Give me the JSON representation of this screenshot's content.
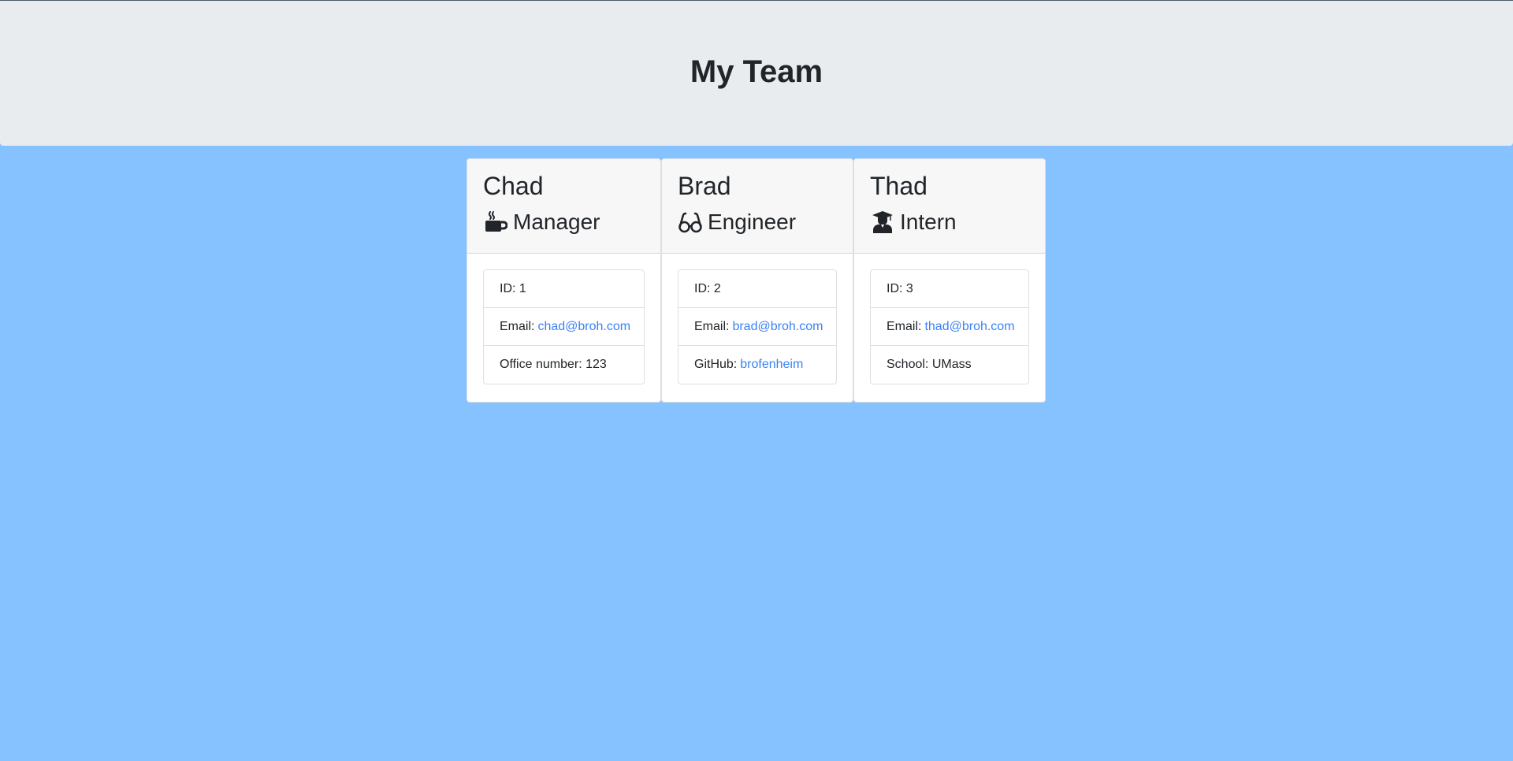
{
  "header": {
    "title": "My Team"
  },
  "team": [
    {
      "name": "Chad",
      "role": "Manager",
      "role_icon": "mug-hot-icon",
      "id_label": "ID: 1",
      "email_label": "Email:",
      "email": "chad@broh.com",
      "extra_label": "Office number: 123",
      "extra_link": ""
    },
    {
      "name": "Brad",
      "role": "Engineer",
      "role_icon": "glasses-icon",
      "id_label": "ID: 2",
      "email_label": "Email:",
      "email": "brad@broh.com",
      "extra_label": "GitHub:",
      "extra_link": "brofenheim"
    },
    {
      "name": "Thad",
      "role": "Intern",
      "role_icon": "user-graduate-icon",
      "id_label": "ID: 3",
      "email_label": "Email:",
      "email": "thad@broh.com",
      "extra_label": "School: UMass",
      "extra_link": ""
    }
  ],
  "colors": {
    "background": "#85c2ff",
    "jumbotron": "#e9ecef",
    "link": "#3b82f6"
  }
}
